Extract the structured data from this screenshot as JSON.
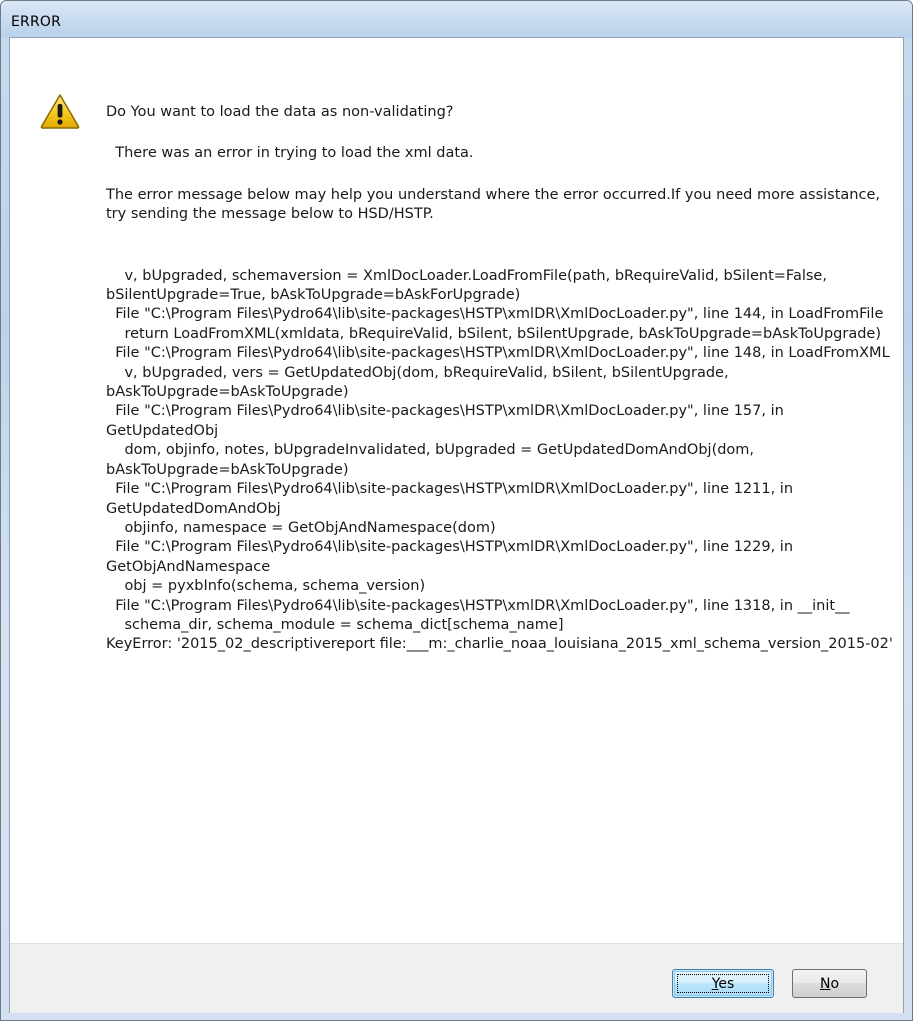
{
  "window": {
    "title": "ERROR"
  },
  "icon": {
    "name": "warning-icon",
    "fill_color": "#f5c518",
    "border_color": "#8a6a00"
  },
  "message": {
    "question": "Do You want to load the data as non-validating?",
    "error_line": "  There was an error in trying to load the xml data.",
    "help": "The error message below may help you understand where the error occurred.If you need more assistance, try sending the message below to HSD/HSTP.",
    "traceback": "    v, bUpgraded, schemaversion = XmlDocLoader.LoadFromFile(path, bRequireValid, bSilent=False, bSilentUpgrade=True, bAskToUpgrade=bAskForUpgrade)\n  File \"C:\\Program Files\\Pydro64\\lib\\site-packages\\HSTP\\xmlDR\\XmlDocLoader.py\", line 144, in LoadFromFile\n    return LoadFromXML(xmldata, bRequireValid, bSilent, bSilentUpgrade, bAskToUpgrade=bAskToUpgrade)\n  File \"C:\\Program Files\\Pydro64\\lib\\site-packages\\HSTP\\xmlDR\\XmlDocLoader.py\", line 148, in LoadFromXML\n    v, bUpgraded, vers = GetUpdatedObj(dom, bRequireValid, bSilent, bSilentUpgrade, bAskToUpgrade=bAskToUpgrade)\n  File \"C:\\Program Files\\Pydro64\\lib\\site-packages\\HSTP\\xmlDR\\XmlDocLoader.py\", line 157, in GetUpdatedObj\n    dom, objinfo, notes, bUpgradeInvalidated, bUpgraded = GetUpdatedDomAndObj(dom, bAskToUpgrade=bAskToUpgrade)\n  File \"C:\\Program Files\\Pydro64\\lib\\site-packages\\HSTP\\xmlDR\\XmlDocLoader.py\", line 1211, in GetUpdatedDomAndObj\n    objinfo, namespace = GetObjAndNamespace(dom)\n  File \"C:\\Program Files\\Pydro64\\lib\\site-packages\\HSTP\\xmlDR\\XmlDocLoader.py\", line 1229, in GetObjAndNamespace\n    obj = pyxbInfo(schema, schema_version)\n  File \"C:\\Program Files\\Pydro64\\lib\\site-packages\\HSTP\\xmlDR\\XmlDocLoader.py\", line 1318, in __init__\n    schema_dir, schema_module = schema_dict[schema_name]\nKeyError: '2015_02_descriptivereport file:___m:_charlie_noaa_louisiana_2015_xml_schema_version_2015-02'"
  },
  "buttons": {
    "yes": {
      "mnemonic": "Y",
      "rest": "es"
    },
    "no": {
      "mnemonic": "N",
      "rest": "o"
    }
  },
  "colors": {
    "frame": "#bcd3ea",
    "footer": "#f0f0f0",
    "default_button_border": "#3c7fb1"
  }
}
